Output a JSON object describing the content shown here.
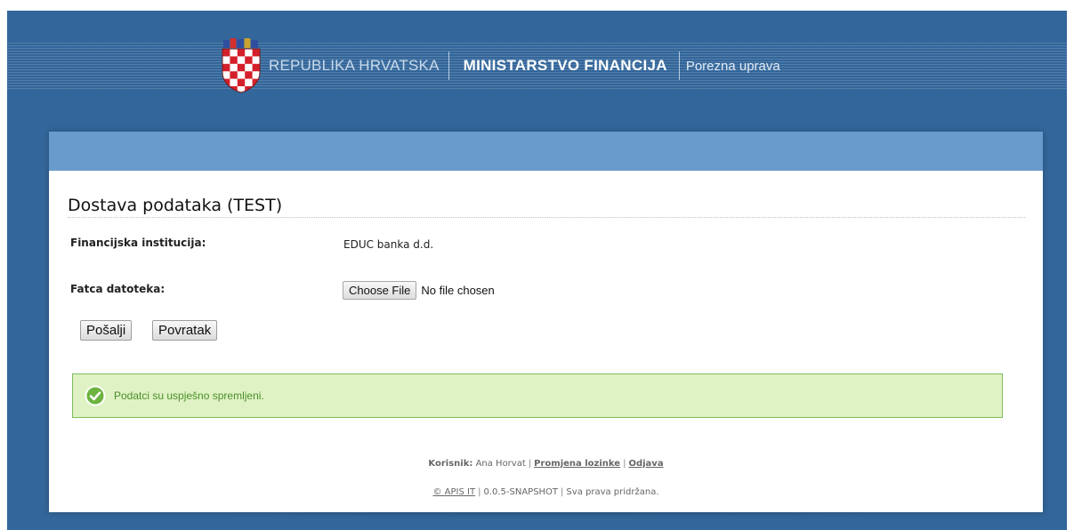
{
  "header": {
    "republic": "REPUBLIKA HRVATSKA",
    "ministry": "MINISTARSTVO FINANCIJA",
    "department": "Porezna uprava",
    "crest_icon": "croatian-coat-of-arms",
    "background_color": "#33669a"
  },
  "page": {
    "title": "Dostava podataka (TEST)"
  },
  "form": {
    "institution_label": "Financijska institucija:",
    "institution_value": "EDUC banka d.d.",
    "file_label": "Fatca datoteka:",
    "file_button": "Choose File",
    "file_status": "No file chosen",
    "submit_label": "Pošalji",
    "back_label": "Povratak"
  },
  "message": {
    "text": "Podatci su uspješno spremljeni.",
    "icon": "checkmark-icon",
    "color": "#dff2c4"
  },
  "footer": {
    "user_label": "Korisnik:",
    "user_name": "Ana Horvat",
    "change_password": "Promjena lozinke",
    "logout": "Odjava",
    "copyright": "© APIS IT",
    "version": "0.0.5-SNAPSHOT",
    "rights": "Sva prava pridržana."
  }
}
